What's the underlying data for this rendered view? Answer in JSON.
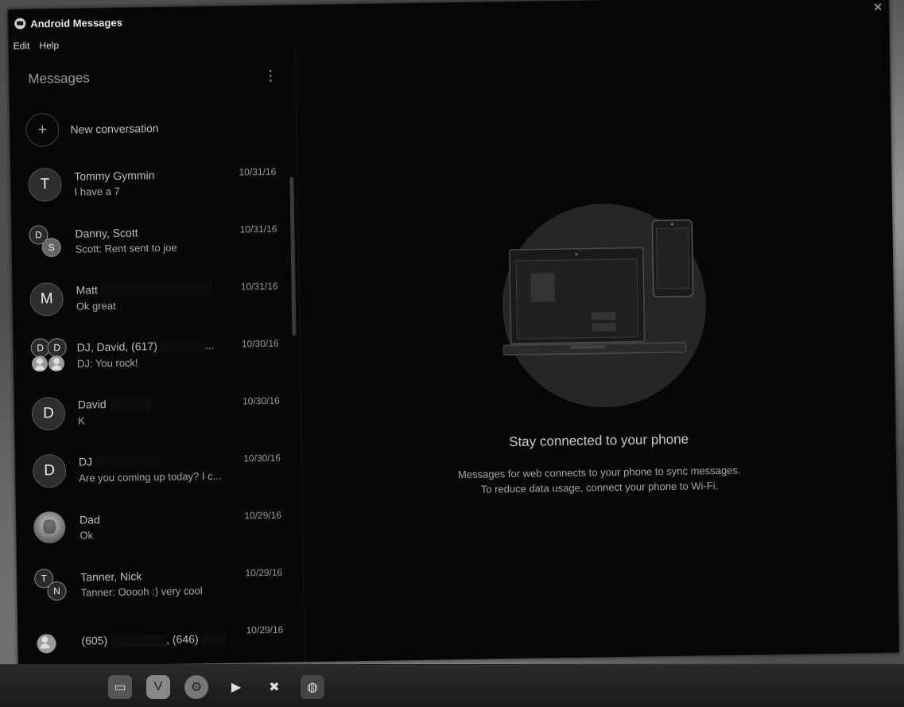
{
  "window": {
    "title": "Android Messages",
    "close_glyph": "✕"
  },
  "menu": {
    "edit": "Edit",
    "help": "Help"
  },
  "sidebar": {
    "title": "Messages",
    "more_glyph": "⋮",
    "new_conversation": {
      "icon": "+",
      "label": "New conversation"
    }
  },
  "conversations": [
    {
      "name": "Tommy Gymmin",
      "snippet": "I have a 7",
      "date": "10/31/16",
      "avatar": "T"
    },
    {
      "name": "Danny, Scott",
      "snippet": "Scott: Rent sent to joe",
      "date": "10/31/16",
      "avatar_a": "D",
      "avatar_b": "S"
    },
    {
      "name": "Matt",
      "snippet": "Ok great",
      "date": "10/31/16",
      "avatar": "M"
    },
    {
      "name": "DJ, David, (617)",
      "name_tail": "...",
      "snippet": "DJ: You rock!",
      "date": "10/30/16",
      "avatar_a": "D",
      "avatar_b": "D"
    },
    {
      "name": "David",
      "snippet": "K",
      "date": "10/30/16",
      "avatar": "D"
    },
    {
      "name": "DJ",
      "snippet": "Are you coming up today? I c...",
      "date": "10/30/16",
      "avatar": "D"
    },
    {
      "name": "Dad",
      "snippet": "Ok",
      "date": "10/29/16"
    },
    {
      "name": "Tanner, Nick",
      "snippet": "Tanner: Ooooh :) very cool",
      "date": "10/29/16",
      "avatar_a": "T",
      "avatar_b": "N"
    },
    {
      "name": "(605)",
      "name_tail": ", (646)",
      "date": "10/29/16"
    }
  ],
  "main": {
    "title": "Stay connected to your phone",
    "line1": "Messages for web connects to your phone to sync messages.",
    "line2": "To reduce data usage, connect your phone to Wi-Fi."
  },
  "taskbar": {
    "icons": [
      "file-manager-icon",
      "vivaldi-icon",
      "steam-icon",
      "play-store-icon",
      "tools-icon",
      "android-messages-icon"
    ]
  }
}
